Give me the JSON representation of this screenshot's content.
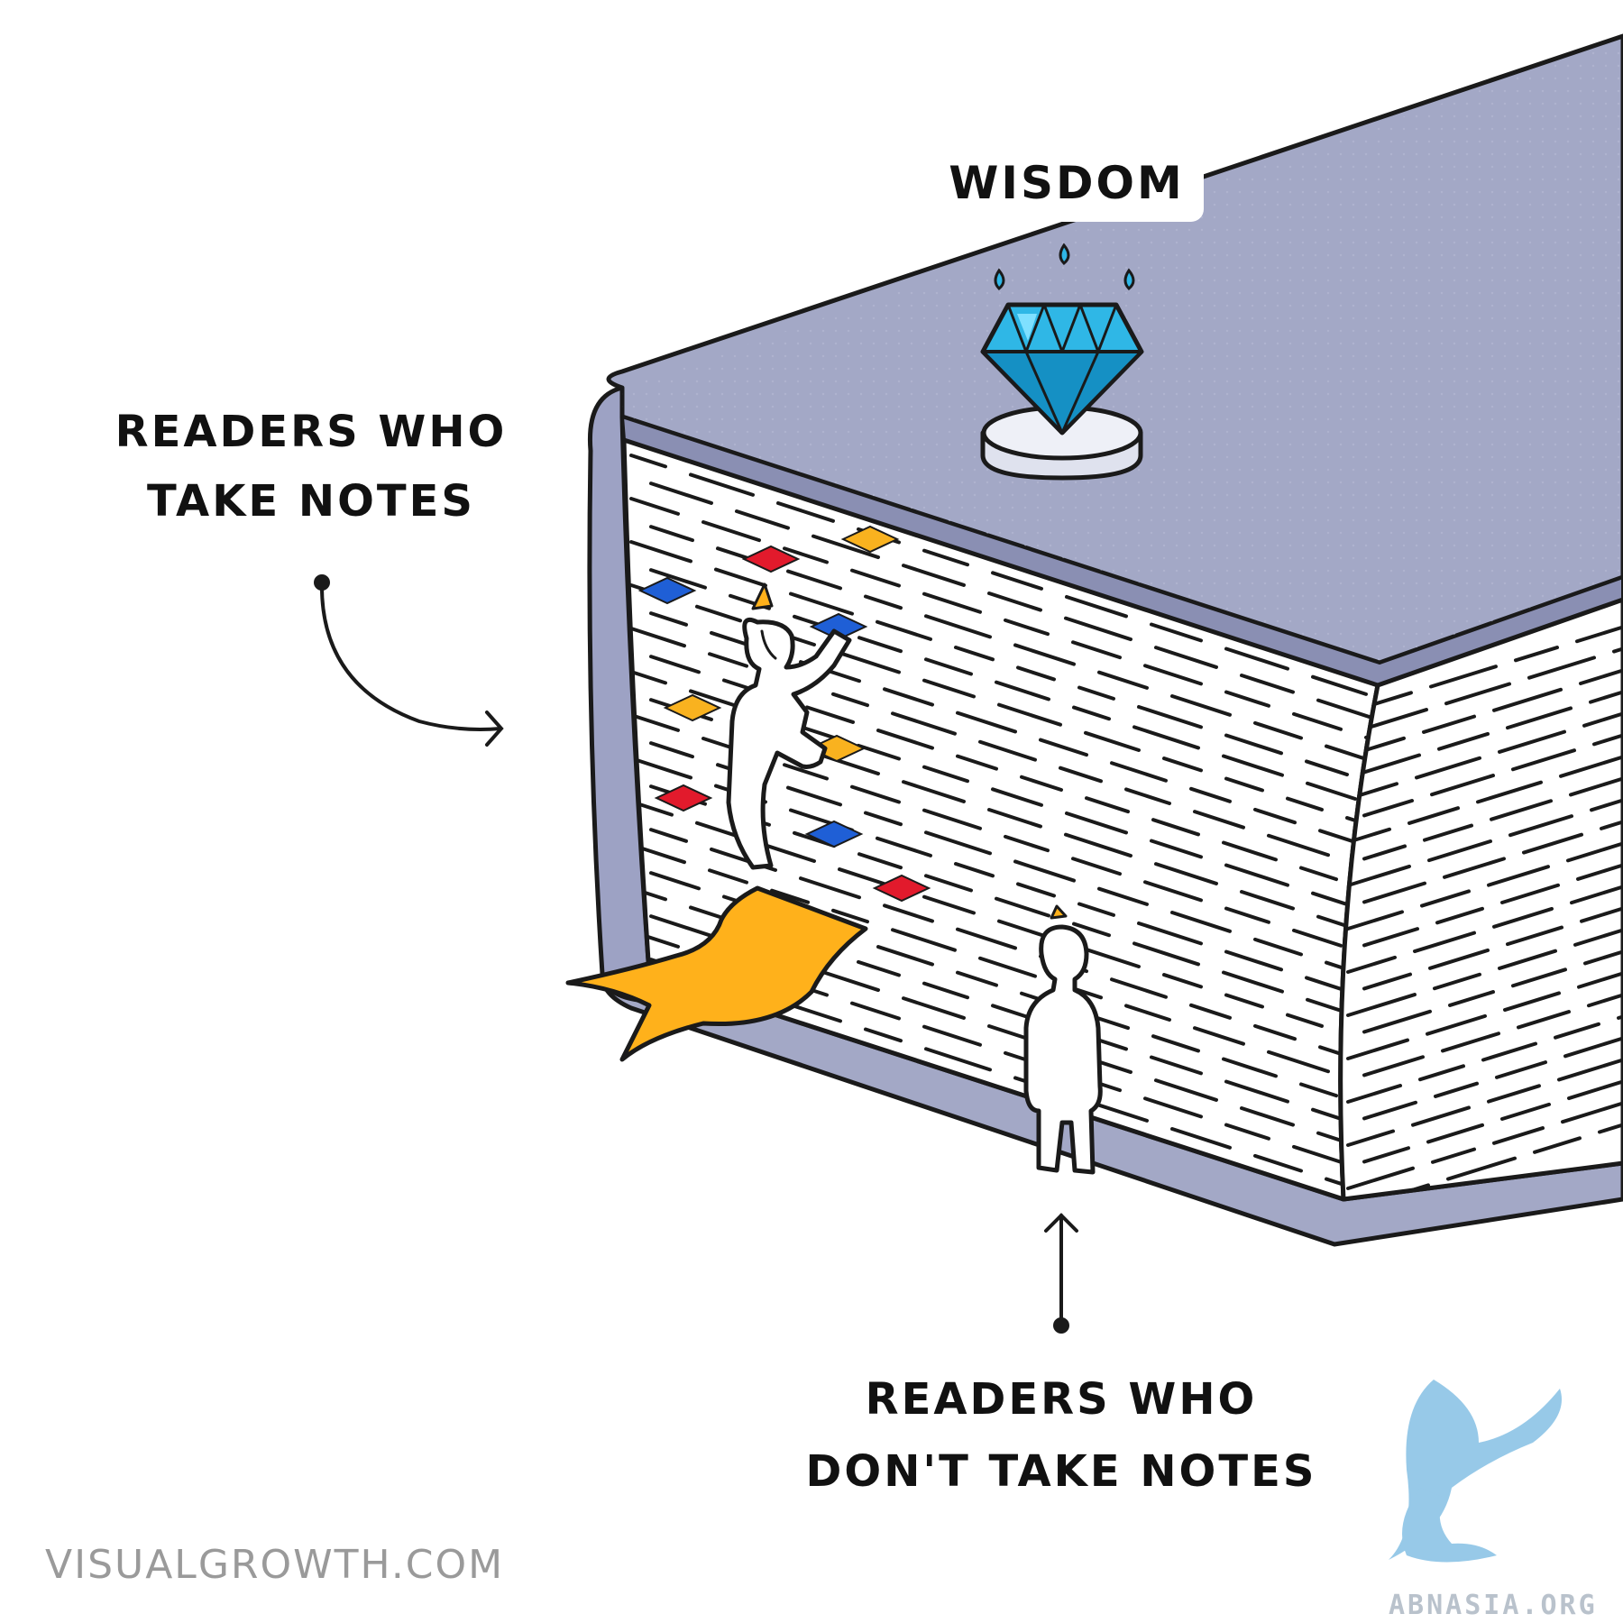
{
  "labels": {
    "wisdom": "WISDOM",
    "note_takers_line1": "READERS WHO",
    "note_takers_line2": "TAKE NOTES",
    "non_note_takers_line1": "READERS WHO",
    "non_note_takers_line2": "DON'T TAKE NOTES"
  },
  "credit": "VISUALGROWTH.COM",
  "watermark": "ABNASIA.ORG",
  "colors": {
    "book_cover": "#a3a8c6",
    "book_cover_dark": "#8a8fb3",
    "pages": "#ffffff",
    "outline": "#1a1a1a",
    "diamond": "#2fb7e6",
    "diamond_dark": "#1590c4",
    "bookmark": "#ffb11b",
    "hold_red": "#e21a2c",
    "hold_blue": "#1f5fd6",
    "hold_yellow": "#f9b21f",
    "watermark": "#8cc4e6"
  },
  "icons": [
    "diamond-icon",
    "climbing-person-icon",
    "standing-person-icon",
    "bookmark-ribbon-icon",
    "griffin-logo-icon"
  ]
}
